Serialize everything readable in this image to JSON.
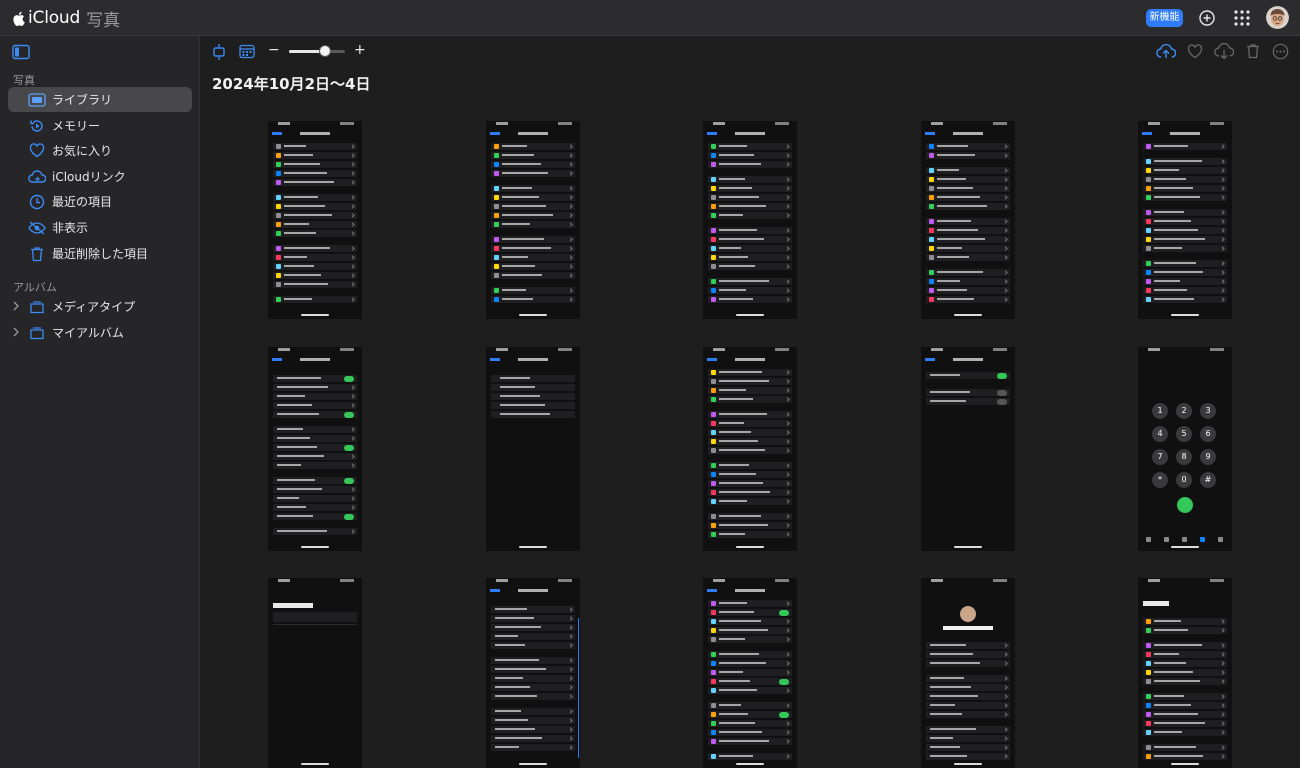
{
  "topbar": {
    "brand_name": "iCloud",
    "app_name": "写真",
    "new_feature_label": "新機能",
    "accent": "#2f7cf6"
  },
  "sidebar": {
    "photos_section": "写真",
    "items": [
      {
        "label": "ライブラリ",
        "icon": "library-icon",
        "selected": true
      },
      {
        "label": "メモリー",
        "icon": "memories-icon"
      },
      {
        "label": "お気に入り",
        "icon": "heart-icon"
      },
      {
        "label": "iCloudリンク",
        "icon": "cloud-link-icon"
      },
      {
        "label": "最近の項目",
        "icon": "clock-icon"
      },
      {
        "label": "非表示",
        "icon": "eye-slash-icon"
      },
      {
        "label": "最近削除した項目",
        "icon": "trash-icon"
      }
    ],
    "albums_section": "アルバム",
    "albums": [
      {
        "label": "メディアタイプ",
        "icon": "folder-icon"
      },
      {
        "label": "マイアルバム",
        "icon": "folder-icon"
      }
    ]
  },
  "toolbar": {
    "date_range": "2024年10月2日〜4日",
    "zoom_level": 0.65,
    "minus": "−",
    "plus": "+"
  },
  "thumbnails": {
    "count": 15,
    "rows": 3,
    "columns": 5,
    "dialer_keys": [
      "1",
      "2",
      "3",
      "4",
      "5",
      "6",
      "7",
      "8",
      "9",
      "*",
      "0",
      "#"
    ],
    "profile_name": "Shigeki Ishitani"
  }
}
